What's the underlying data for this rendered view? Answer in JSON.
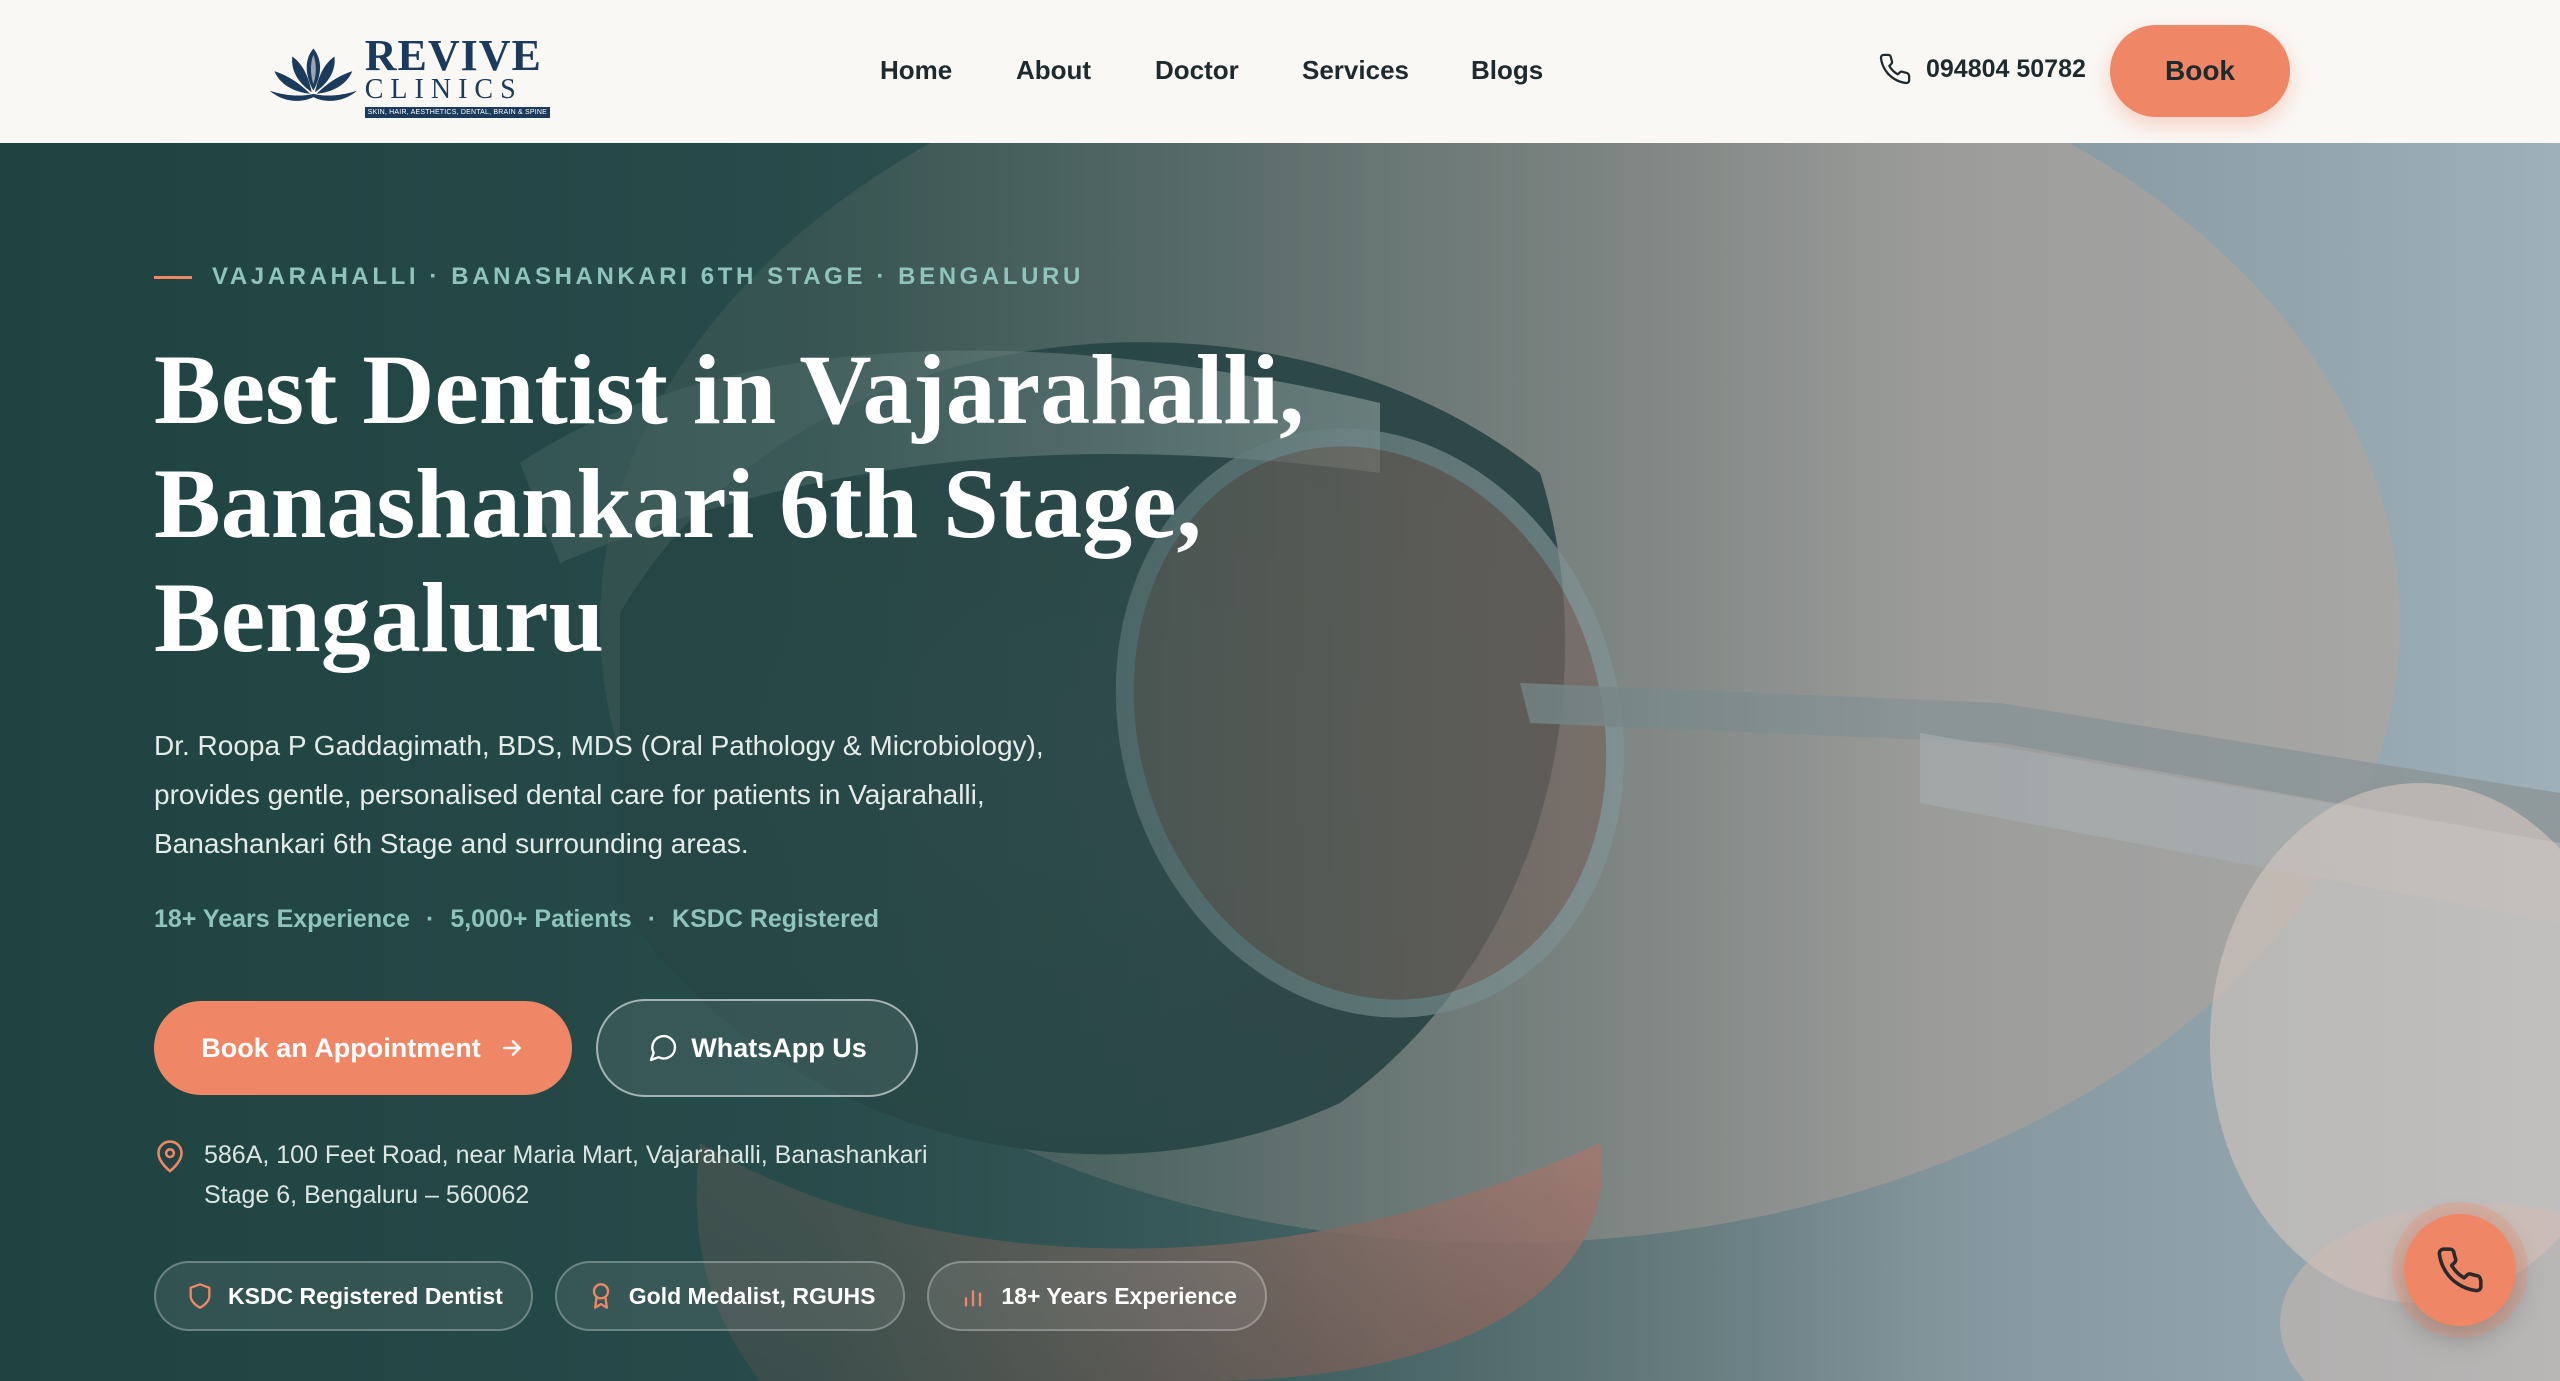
{
  "brand": {
    "name": "REVIVE",
    "sub": "CLINICS",
    "tagline": "SKIN, HAIR, AESTHETICS, DENTAL, BRAIN & SPINE",
    "logo_icon": "lotus-icon",
    "primary_color": "#1b3a5c",
    "accent_color": "#ef8766"
  },
  "nav": {
    "items": [
      "Home",
      "About",
      "Doctor",
      "Services",
      "Blogs"
    ],
    "phone_icon": "phone-icon",
    "phone": "094804 50782",
    "book_label": "Book"
  },
  "hero": {
    "eyebrow": "VAJARAHALLI · BANASHANKARI 6TH STAGE · BENGALURU",
    "title_lines": [
      "Best Dentist in Vajarahalli,",
      "Banashankari 6th Stage,",
      "Bengaluru"
    ],
    "description_lines": [
      "Dr. Roopa P Gaddagimath, BDS, MDS (Oral Pathology & Microbiology),",
      "provides gentle, personalised dental care for patients in Vajarahalli,",
      "Banashankari 6th Stage and surrounding areas."
    ],
    "stats": [
      "18+ Years Experience",
      "5,000+ Patients",
      "KSDC Registered"
    ],
    "stat_separator": "·",
    "cta_primary": "Book an Appointment",
    "cta_primary_icon": "arrow-right-icon",
    "cta_secondary": "WhatsApp Us",
    "cta_secondary_icon": "chat-bubble-icon",
    "address_icon": "map-pin-icon",
    "address_lines": [
      "586A, 100 Feet Road, near Maria Mart, Vajarahalli, Banashankari",
      "Stage 6, Bengaluru – 560062"
    ],
    "badges": [
      {
        "label": "KSDC Registered Dentist",
        "icon": "shield-icon"
      },
      {
        "label": "Gold Medalist, RGUHS",
        "icon": "award-icon"
      },
      {
        "label": "18+ Years Experience",
        "icon": "bar-chart-icon"
      }
    ]
  },
  "floating_call": {
    "icon": "phone-icon"
  }
}
